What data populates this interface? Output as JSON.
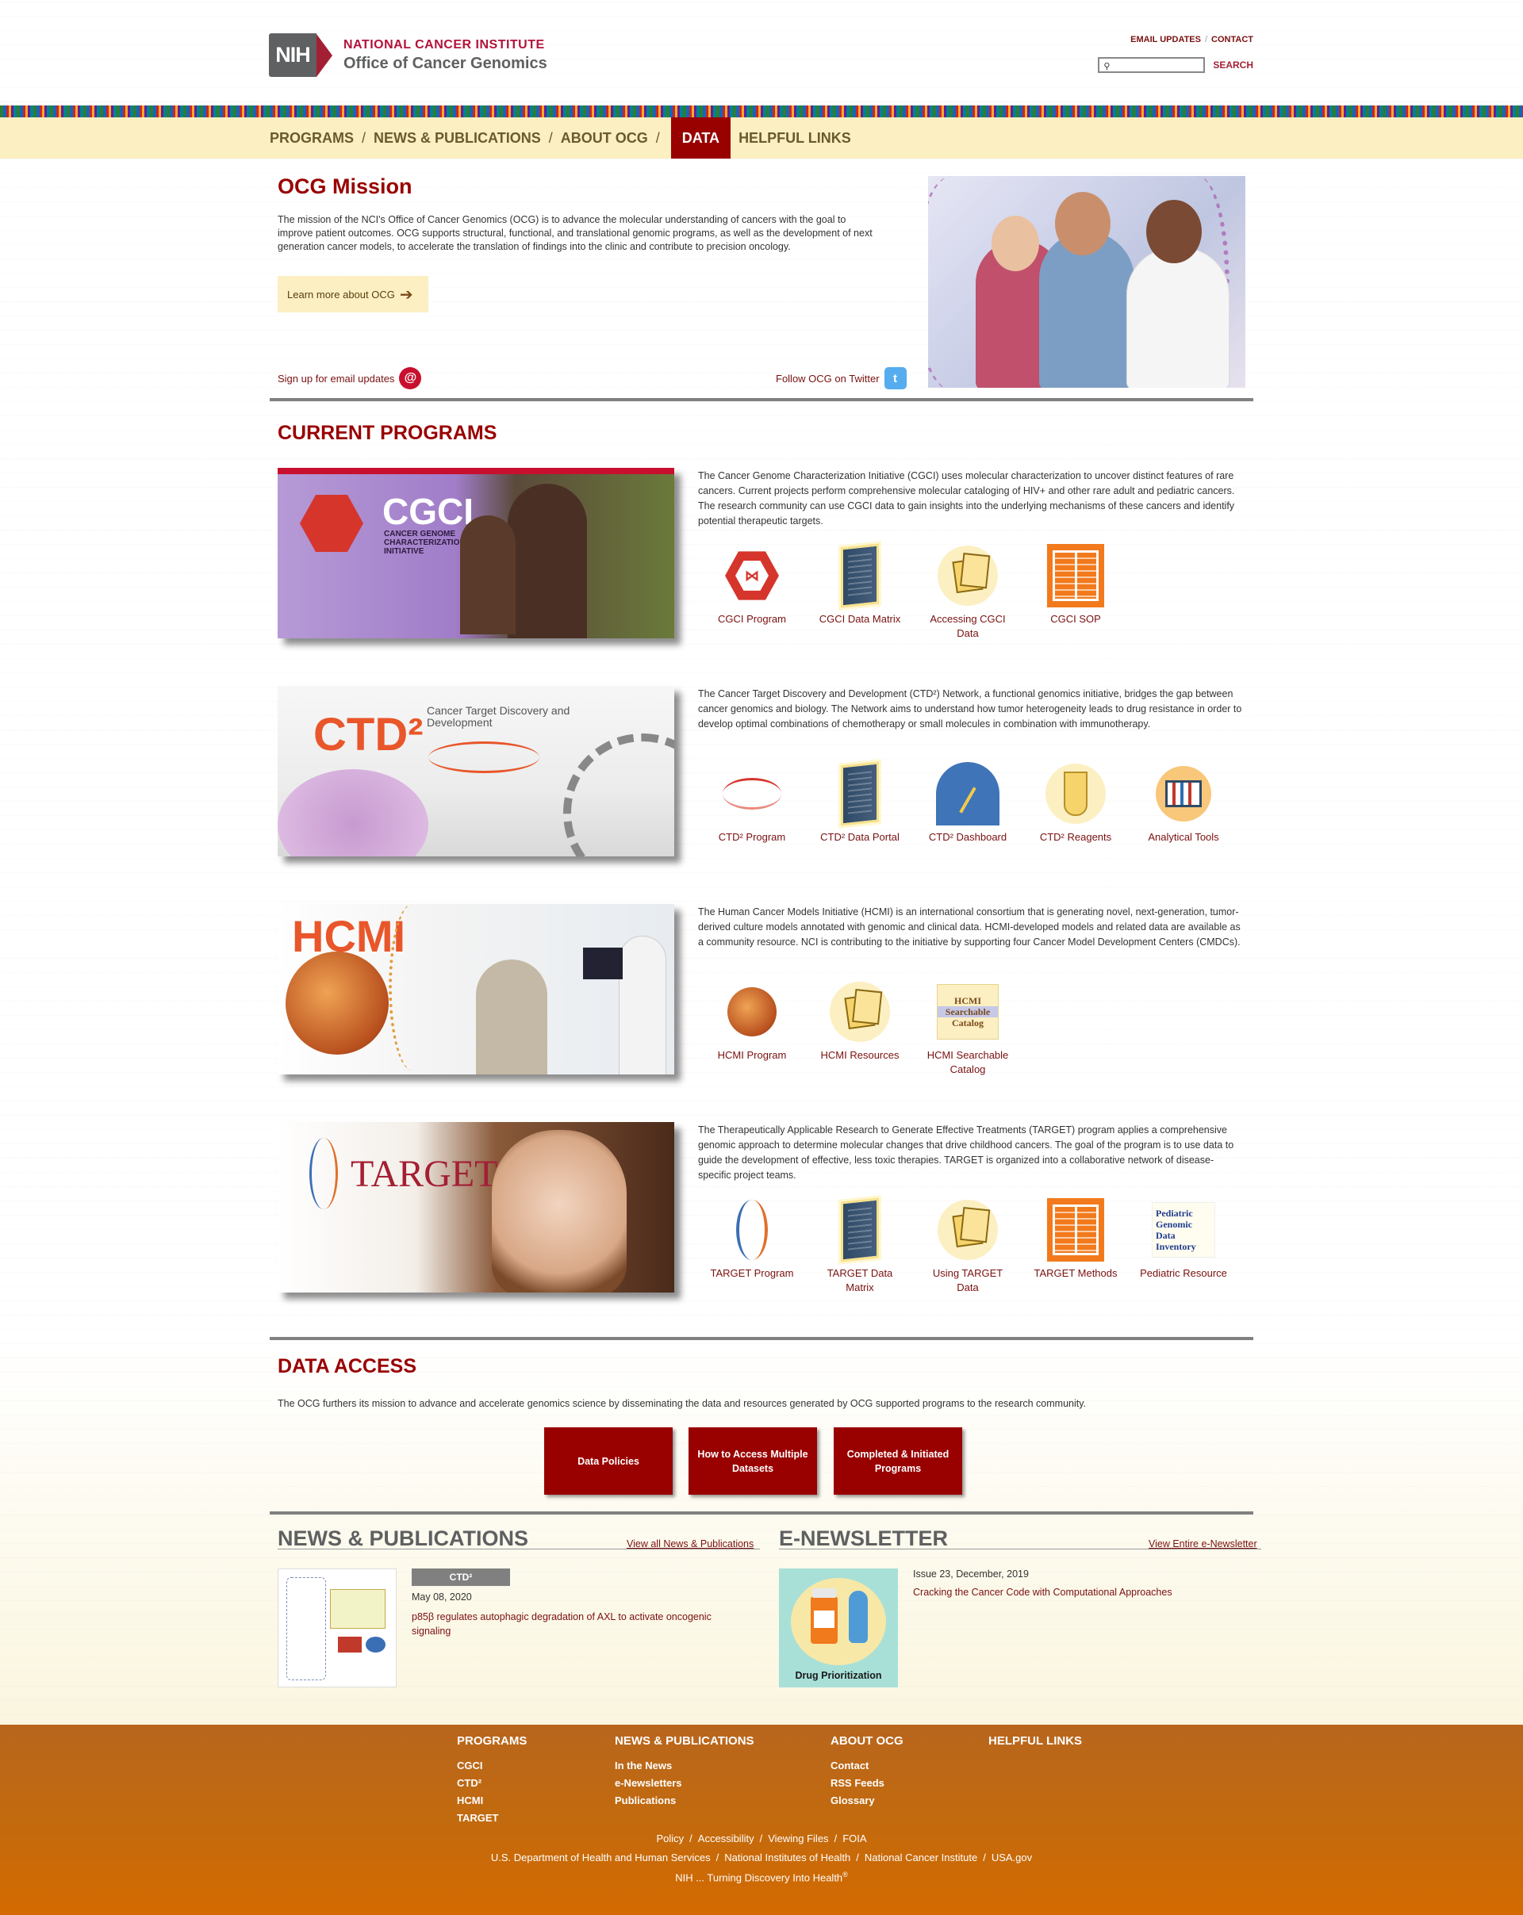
{
  "header": {
    "org_line1": "NATIONAL CANCER INSTITUTE",
    "org_line2": "Office of Cancer Genomics",
    "nih_label": "NIH",
    "email_updates": "EMAIL UPDATES",
    "contact": "CONTACT",
    "search_placeholder": "",
    "search_button": "SEARCH"
  },
  "nav": {
    "items": [
      "PROGRAMS",
      "NEWS & PUBLICATIONS",
      "ABOUT OCG",
      "DATA",
      "HELPFUL LINKS"
    ],
    "active": "DATA"
  },
  "mission": {
    "title": "OCG Mission",
    "text": "The mission of the NCI's Office of Cancer Genomics (OCG) is to advance the molecular understanding of cancers with the goal to improve patient outcomes. OCG supports structural, functional, and translational genomic programs, as well as the development of next generation cancer models, to accelerate the translation of findings into the clinic and contribute to precision oncology.",
    "learn_more": "Learn more about OCG",
    "signup": "Sign up for email updates",
    "follow": "Follow OCG on Twitter"
  },
  "programs": {
    "title": "CURRENT PROGRAMS",
    "cgci": {
      "banner_title": "CGCI",
      "banner_sub": "CANCER GENOME CHARACTERIZATION INITIATIVE",
      "desc": "The Cancer Genome Characterization Initiative (CGCI) uses molecular characterization to uncover distinct features of rare cancers. Current projects perform comprehensive molecular cataloging of HIV+ and other rare adult and pediatric cancers. The research community can use CGCI data to gain insights into the underlying mechanisms of these cancers and identify potential therapeutic targets.",
      "links": [
        "CGCI Program",
        "CGCI Data Matrix",
        "Accessing CGCI Data",
        "CGCI SOP"
      ]
    },
    "ctd2": {
      "banner_title": "CTD²",
      "banner_sub": "Cancer Target Discovery and Development",
      "desc": "The Cancer Target Discovery and Development (CTD²) Network, a functional genomics initiative, bridges the gap between cancer genomics and biology. The Network aims to understand how tumor heterogeneity leads to drug resistance in order to develop optimal combinations of chemotherapy or small molecules in combination with immunotherapy.",
      "links": [
        "CTD² Program",
        "CTD² Data Portal",
        "CTD² Dashboard",
        "CTD² Reagents",
        "Analytical Tools"
      ]
    },
    "hcmi": {
      "banner_title": "HCMI",
      "desc": "The Human Cancer Models Initiative (HCMI) is an international consortium that is generating novel, next-generation, tumor-derived culture models annotated with genomic and clinical data. HCMI-developed models and related data are available as a community resource. NCI is contributing to the initiative by supporting four Cancer Model Development Centers (CMDCs).",
      "links": [
        "HCMI Program",
        "HCMI Resources",
        "HCMI Searchable Catalog"
      ],
      "catalog_icon": [
        "HCMI",
        "Searchable",
        "Catalog"
      ]
    },
    "target": {
      "banner_title": "TARGET",
      "desc": "The Therapeutically Applicable Research to Generate Effective Treatments (TARGET) program applies a comprehensive genomic approach to determine molecular changes that drive childhood cancers. The goal of the program is to use data to guide the development of effective, less toxic therapies. TARGET is organized into a collaborative network of disease-specific project teams.",
      "links": [
        "TARGET Program",
        "TARGET Data Matrix",
        "Using TARGET Data",
        "TARGET Methods",
        "Pediatric Resource"
      ],
      "pgdi_icon": [
        "Pediatric",
        "Genomic",
        "Data",
        "Inventory"
      ]
    }
  },
  "data_access": {
    "title": "DATA ACCESS",
    "text": "The OCG furthers its mission to advance and accelerate genomics science by disseminating the data and resources generated by OCG supported programs to the research community.",
    "buttons": [
      "Data Policies",
      "How to Access Multiple Datasets",
      "Completed & Initiated Programs"
    ]
  },
  "news": {
    "title": "NEWS & PUBLICATIONS",
    "view_all": "View all News & Publications",
    "tag": "CTD²",
    "date": "May 08, 2020",
    "headline": "p85β regulates autophagic degradation of AXL to activate oncogenic signaling"
  },
  "enewsletter": {
    "title": "E-NEWSLETTER",
    "view_all": "View Entire e-Newsletter",
    "thumb_caption": "Drug Prioritization",
    "issue": "Issue 23, December, 2019",
    "headline": "Cracking the Cancer Code with Computational Approaches"
  },
  "footer": {
    "cols": [
      {
        "head": "PROGRAMS",
        "items": [
          "CGCI",
          "CTD²",
          "HCMI",
          "TARGET"
        ]
      },
      {
        "head": "NEWS & PUBLICATIONS",
        "items": [
          "In the News",
          "e-Newsletters",
          "Publications"
        ]
      },
      {
        "head": "ABOUT OCG",
        "items": [
          "Contact",
          "RSS Feeds",
          "Glossary"
        ]
      },
      {
        "head": "HELPFUL LINKS",
        "items": []
      }
    ],
    "line1": [
      "Policy",
      "Accessibility",
      "Viewing Files",
      "FOIA"
    ],
    "line2": [
      "U.S. Department of Health and Human Services",
      "National Institutes of Health",
      "National Cancer Institute",
      "USA.gov"
    ],
    "tagline": "NIH ... Turning Discovery Into Health",
    "tagline_mark": "®"
  }
}
